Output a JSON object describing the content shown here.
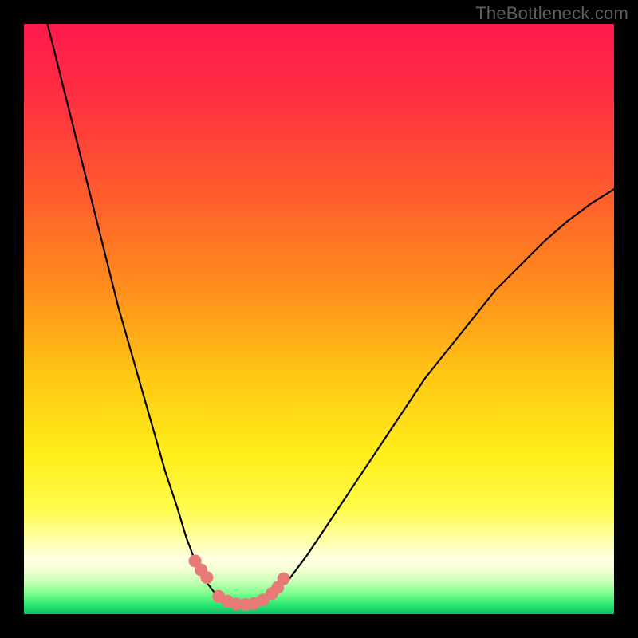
{
  "watermark": "TheBottleneck.com",
  "colors": {
    "black": "#000000",
    "curve": "#000000",
    "marker": "#e77a76",
    "gradient_stops": [
      {
        "offset": 0.0,
        "color": "#ff1a4b"
      },
      {
        "offset": 0.12,
        "color": "#ff2e42"
      },
      {
        "offset": 0.28,
        "color": "#ff5a2e"
      },
      {
        "offset": 0.45,
        "color": "#ff8e1c"
      },
      {
        "offset": 0.6,
        "color": "#ffc814"
      },
      {
        "offset": 0.73,
        "color": "#ffee1a"
      },
      {
        "offset": 0.82,
        "color": "#fffb4a"
      },
      {
        "offset": 0.875,
        "color": "#ffffa8"
      },
      {
        "offset": 0.905,
        "color": "#ffffe0"
      },
      {
        "offset": 0.925,
        "color": "#f4ffd4"
      },
      {
        "offset": 0.945,
        "color": "#c6ffb4"
      },
      {
        "offset": 0.965,
        "color": "#7dff8e"
      },
      {
        "offset": 0.985,
        "color": "#28e670"
      },
      {
        "offset": 1.0,
        "color": "#10c060"
      }
    ]
  },
  "chart_data": {
    "type": "line",
    "title": "",
    "xlabel": "",
    "ylabel": "",
    "xlim": [
      0,
      100
    ],
    "ylim": [
      0,
      100
    ],
    "series": [
      {
        "name": "left-branch",
        "x": [
          4,
          6,
          8,
          10,
          12,
          14,
          16,
          18,
          20,
          22,
          24,
          26,
          27.5,
          29,
          30.5,
          32,
          33
        ],
        "values": [
          100,
          92,
          84,
          76,
          68,
          60,
          52,
          45,
          38,
          31,
          24,
          18,
          13,
          9,
          6,
          4,
          3
        ]
      },
      {
        "name": "valley-floor",
        "x": [
          33,
          34,
          35,
          36,
          37,
          38,
          39,
          40,
          41,
          42
        ],
        "values": [
          3,
          2.2,
          1.8,
          1.6,
          1.6,
          1.6,
          1.8,
          2.2,
          2.8,
          3.5
        ]
      },
      {
        "name": "right-branch",
        "x": [
          42,
          45,
          48,
          52,
          56,
          60,
          64,
          68,
          72,
          76,
          80,
          84,
          88,
          92,
          96,
          100
        ],
        "values": [
          3.5,
          6,
          10,
          16,
          22,
          28,
          34,
          40,
          45,
          50,
          55,
          59,
          63,
          66.5,
          69.5,
          72
        ]
      }
    ],
    "markers": {
      "name": "highlight-dots",
      "color": "#e77a76",
      "x": [
        29.0,
        30.0,
        31.0,
        33.0,
        34.5,
        36.0,
        37.5,
        39.0,
        40.5,
        42.0,
        43.0,
        44.0
      ],
      "values": [
        9.0,
        7.5,
        6.2,
        3.0,
        2.2,
        1.7,
        1.6,
        1.8,
        2.4,
        3.5,
        4.5,
        6.0
      ]
    }
  }
}
